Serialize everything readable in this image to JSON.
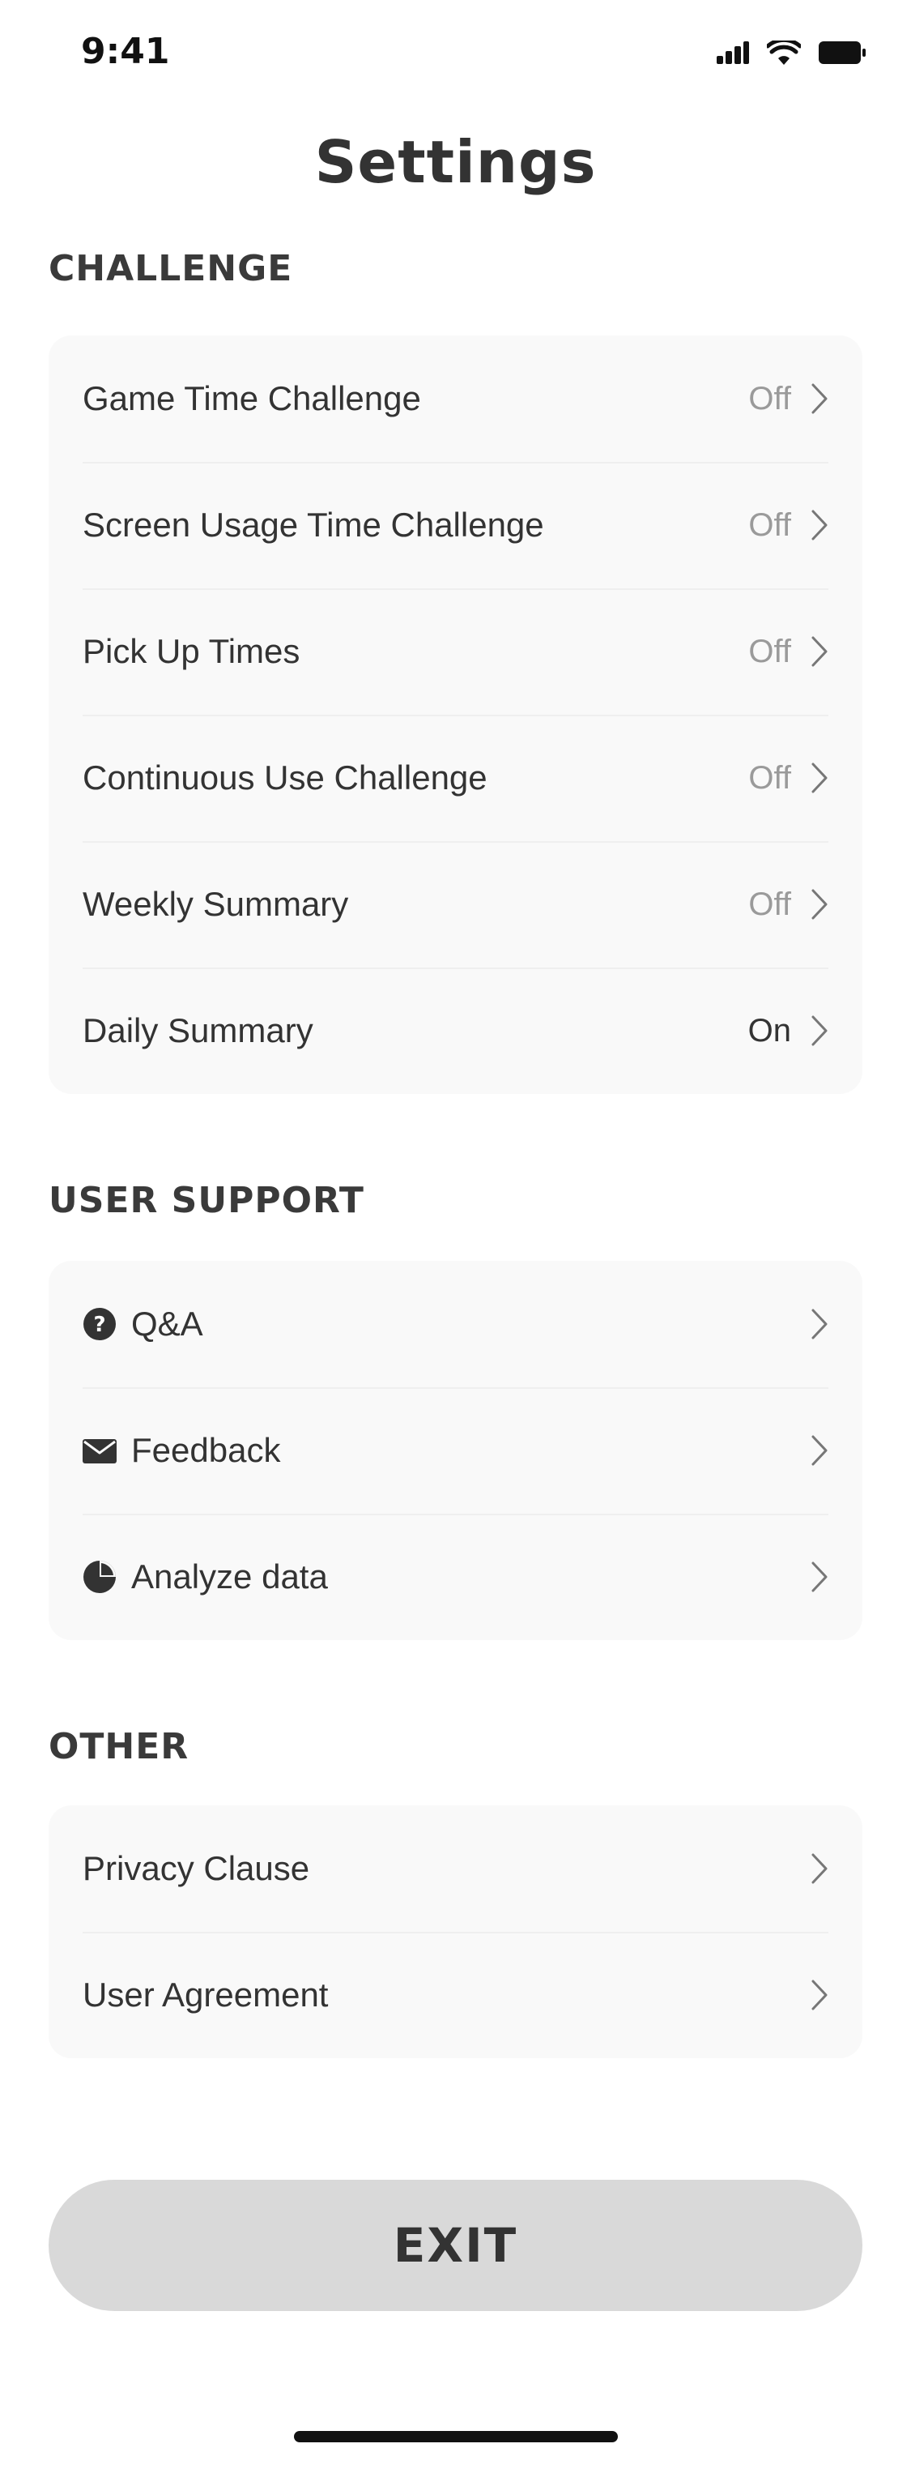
{
  "status_bar": {
    "time": "9:41",
    "icons": [
      "signal-icon",
      "wifi-icon",
      "battery-icon"
    ]
  },
  "title": "Settings",
  "sections": {
    "challenge": {
      "header": "CHALLENGE",
      "items": [
        {
          "label": "Game Time Challenge",
          "value": "Off"
        },
        {
          "label": "Screen Usage Time Challenge",
          "value": "Off"
        },
        {
          "label": "Pick Up Times",
          "value": "Off"
        },
        {
          "label": "Continuous Use Challenge",
          "value": "Off"
        },
        {
          "label": "Weekly Summary",
          "value": "Off"
        },
        {
          "label": "Daily Summary",
          "value": "On"
        }
      ]
    },
    "user_support": {
      "header": "USER SUPPORT",
      "items": [
        {
          "label": "Q&A",
          "icon": "question-icon"
        },
        {
          "label": "Feedback",
          "icon": "mail-icon"
        },
        {
          "label": "Analyze data",
          "icon": "pie-chart-icon"
        }
      ]
    },
    "other": {
      "header": "OTHER",
      "items": [
        {
          "label": "Privacy Clause"
        },
        {
          "label": "User Agreement"
        }
      ]
    }
  },
  "exit_label": "EXIT",
  "colors": {
    "text": "#333333",
    "muted": "#9a9a9a",
    "card_bg": "#f9f9f9",
    "exit_bg": "#d9d9d9"
  }
}
